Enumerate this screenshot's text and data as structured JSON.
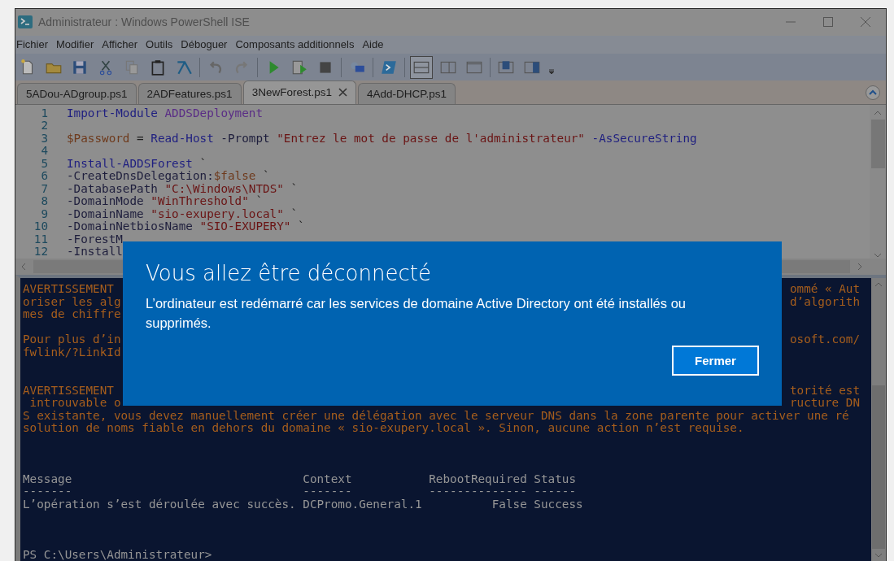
{
  "window": {
    "title": "Administrateur : Windows PowerShell ISE"
  },
  "menu": [
    "Fichier",
    "Modifier",
    "Afficher",
    "Outils",
    "Déboguer",
    "Composants additionnels",
    "Aide"
  ],
  "tabs": [
    {
      "label": "5ADou-ADgroup.ps1",
      "selected": false
    },
    {
      "label": "2ADFeatures.ps1",
      "selected": false
    },
    {
      "label": "3NewForest.ps1",
      "selected": true
    },
    {
      "label": "4Add-DHCP.ps1",
      "selected": false
    }
  ],
  "editor": {
    "lines": [
      {
        "number": "1",
        "tokens": [
          {
            "kind": "cmdlet",
            "text": "Import-Module "
          },
          {
            "kind": "argument",
            "text": "ADDSDeployment"
          }
        ]
      },
      {
        "number": "2"
      },
      {
        "number": "3",
        "tokens": [
          {
            "kind": "variable",
            "text": "$Password"
          },
          {
            "kind": "plain",
            "text": " = "
          },
          {
            "kind": "cmdlet",
            "text": "Read-Host"
          },
          {
            "kind": "param",
            "text": " -Prompt "
          },
          {
            "kind": "string",
            "text": "\"Entrez le mot de passe de l'administrateur\""
          },
          {
            "kind": "cmdlet",
            "text": " -AsSecureString"
          }
        ]
      },
      {
        "number": "4"
      },
      {
        "number": "5",
        "tokens": [
          {
            "kind": "cmdlet",
            "text": "Install-ADDSForest"
          },
          {
            "kind": "plain",
            "text": " `"
          }
        ]
      },
      {
        "number": "6",
        "tokens": [
          {
            "kind": "param",
            "text": "-CreateDnsDelegation:"
          },
          {
            "kind": "variable",
            "text": "$false"
          },
          {
            "kind": "plain",
            "text": " `"
          }
        ]
      },
      {
        "number": "7",
        "tokens": [
          {
            "kind": "param",
            "text": "-DatabasePath "
          },
          {
            "kind": "string",
            "text": "\"C:\\Windows\\NTDS\""
          },
          {
            "kind": "plain",
            "text": " `"
          }
        ]
      },
      {
        "number": "8",
        "tokens": [
          {
            "kind": "param",
            "text": "-DomainMode "
          },
          {
            "kind": "string",
            "text": "\"WinThreshold\""
          },
          {
            "kind": "plain",
            "text": " `"
          }
        ]
      },
      {
        "number": "9",
        "tokens": [
          {
            "kind": "param",
            "text": "-DomainName "
          },
          {
            "kind": "string",
            "text": "\"sio-exupery.local\""
          },
          {
            "kind": "plain",
            "text": " `"
          }
        ]
      },
      {
        "number": "10",
        "tokens": [
          {
            "kind": "param",
            "text": "-DomainNetbiosName "
          },
          {
            "kind": "string",
            "text": "\"SIO-EXUPERY\""
          },
          {
            "kind": "plain",
            "text": " `"
          }
        ]
      },
      {
        "number": "11",
        "tokens": [
          {
            "kind": "param",
            "text": "-ForestM"
          }
        ]
      },
      {
        "number": "12",
        "tokens": [
          {
            "kind": "param",
            "text": "-Install"
          }
        ]
      }
    ]
  },
  "console": {
    "lines": [
      {
        "kind": "warning",
        "left": "AVERTISSEMENT",
        "right": "ommé « Aut"
      },
      {
        "kind": "warning",
        "left": "oriser les alg",
        "right": "d’algorith"
      },
      {
        "kind": "warning",
        "left": "mes de chiffre"
      },
      {
        "kind": "blank"
      },
      {
        "kind": "warning",
        "left": "Pour plus d’in",
        "right": "osoft.com/"
      },
      {
        "kind": "warning",
        "left": "fwlink/?LinkId"
      },
      {
        "kind": "blank"
      },
      {
        "kind": "blank"
      },
      {
        "kind": "warning",
        "left": "AVERTISSEMENT",
        "right": "torité est"
      },
      {
        "kind": "warning",
        "left": " introuvable o",
        "right": "ructure DN"
      },
      {
        "kind": "warning",
        "left": "S existante, vous devez manuellement créer une délégation avec le serveur DNS dans la zone parente pour activer une ré"
      },
      {
        "kind": "warning",
        "left": "solution de noms fiable en dehors du domaine « sio-exupery.local ». Sinon, aucune action n’est requise."
      },
      {
        "kind": "blank"
      },
      {
        "kind": "blank"
      },
      {
        "kind": "blank"
      },
      {
        "kind": "output",
        "left": "Message                                 Context           RebootRequired Status"
      },
      {
        "kind": "output",
        "left": "-------                                 -------           -------------- ------"
      },
      {
        "kind": "output",
        "left": "L’opération s’est déroulée avec succès. DCPromo.General.1          False Success"
      },
      {
        "kind": "blank"
      },
      {
        "kind": "blank"
      },
      {
        "kind": "blank"
      },
      {
        "kind": "output",
        "left": "PS C:\\Users\\Administrateur>"
      }
    ]
  },
  "dialog": {
    "title": "Vous allez être déconnecté",
    "message": "L’ordinateur est redémarré car les services de domaine Active Directory ont été installés ou supprimés.",
    "button": "Fermer"
  }
}
